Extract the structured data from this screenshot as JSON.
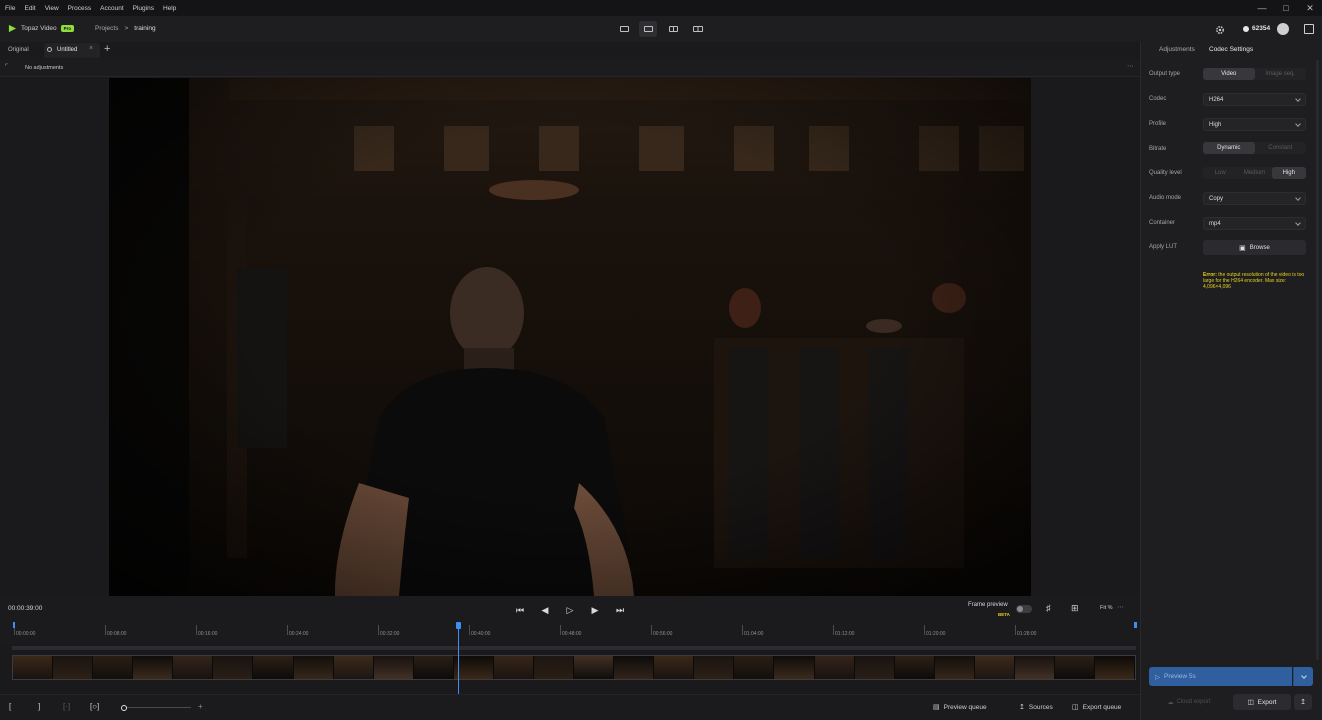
{
  "menu": [
    "File",
    "Edit",
    "View",
    "Process",
    "Account",
    "Plugins",
    "Help"
  ],
  "app": {
    "name": "Topaz Video",
    "badge": "Pro"
  },
  "breadcrumb": {
    "root": "Projects",
    "separator": ">",
    "current": "training"
  },
  "credits": "62354",
  "tabs": {
    "original": "Original",
    "untitled": "Untitled"
  },
  "adjustments_status": "No adjustments",
  "transport": {
    "timecode": "00:00:39:00",
    "frame_preview": "Frame preview",
    "beta": "BETA",
    "fit": "Fit %"
  },
  "timeline": {
    "ticks": [
      "00:00:00",
      "00:08:00",
      "00:16:00",
      "00:24:00",
      "00:32:00",
      "00:40:00",
      "00:48:00",
      "00:56:00",
      "01:04:00",
      "01:12:00",
      "01:20:00",
      "01:28:00"
    ],
    "playhead_fraction": 0.397
  },
  "bottombar": {
    "preview_queue": "Preview queue",
    "sources": "Sources",
    "export_queue": "Export queue"
  },
  "panel": {
    "tabs": {
      "adjustments": "Adjustments",
      "codec": "Codec Settings"
    },
    "output_type": {
      "label": "Output type",
      "options": [
        "Video",
        "Image seq."
      ],
      "selected": "Video"
    },
    "codec": {
      "label": "Codec",
      "value": "H264"
    },
    "profile": {
      "label": "Profile",
      "value": "High"
    },
    "bitrate": {
      "label": "Bitrate",
      "options": [
        "Dynamic",
        "Constant"
      ],
      "selected": "Dynamic"
    },
    "quality": {
      "label": "Quality level",
      "options": [
        "Low",
        "Medium",
        "High"
      ],
      "selected": "High"
    },
    "audio": {
      "label": "Audio mode",
      "value": "Copy"
    },
    "container": {
      "label": "Container",
      "value": "mp4"
    },
    "lut": {
      "label": "Apply LUT",
      "button": "Browse"
    },
    "error": {
      "prefix": "Error:",
      "message": "the output resolution of the video is too large for the H264 encoder. Max size: 4,096×4,096"
    },
    "preview_button": "Preview 5s",
    "cloud_export": "Cloud export",
    "export": "Export"
  },
  "colors": {
    "accent": "#3e8ef7",
    "pro_badge": "#8fdc3a",
    "error": "#e7d21f",
    "preview_button": "#2f5f9e"
  }
}
